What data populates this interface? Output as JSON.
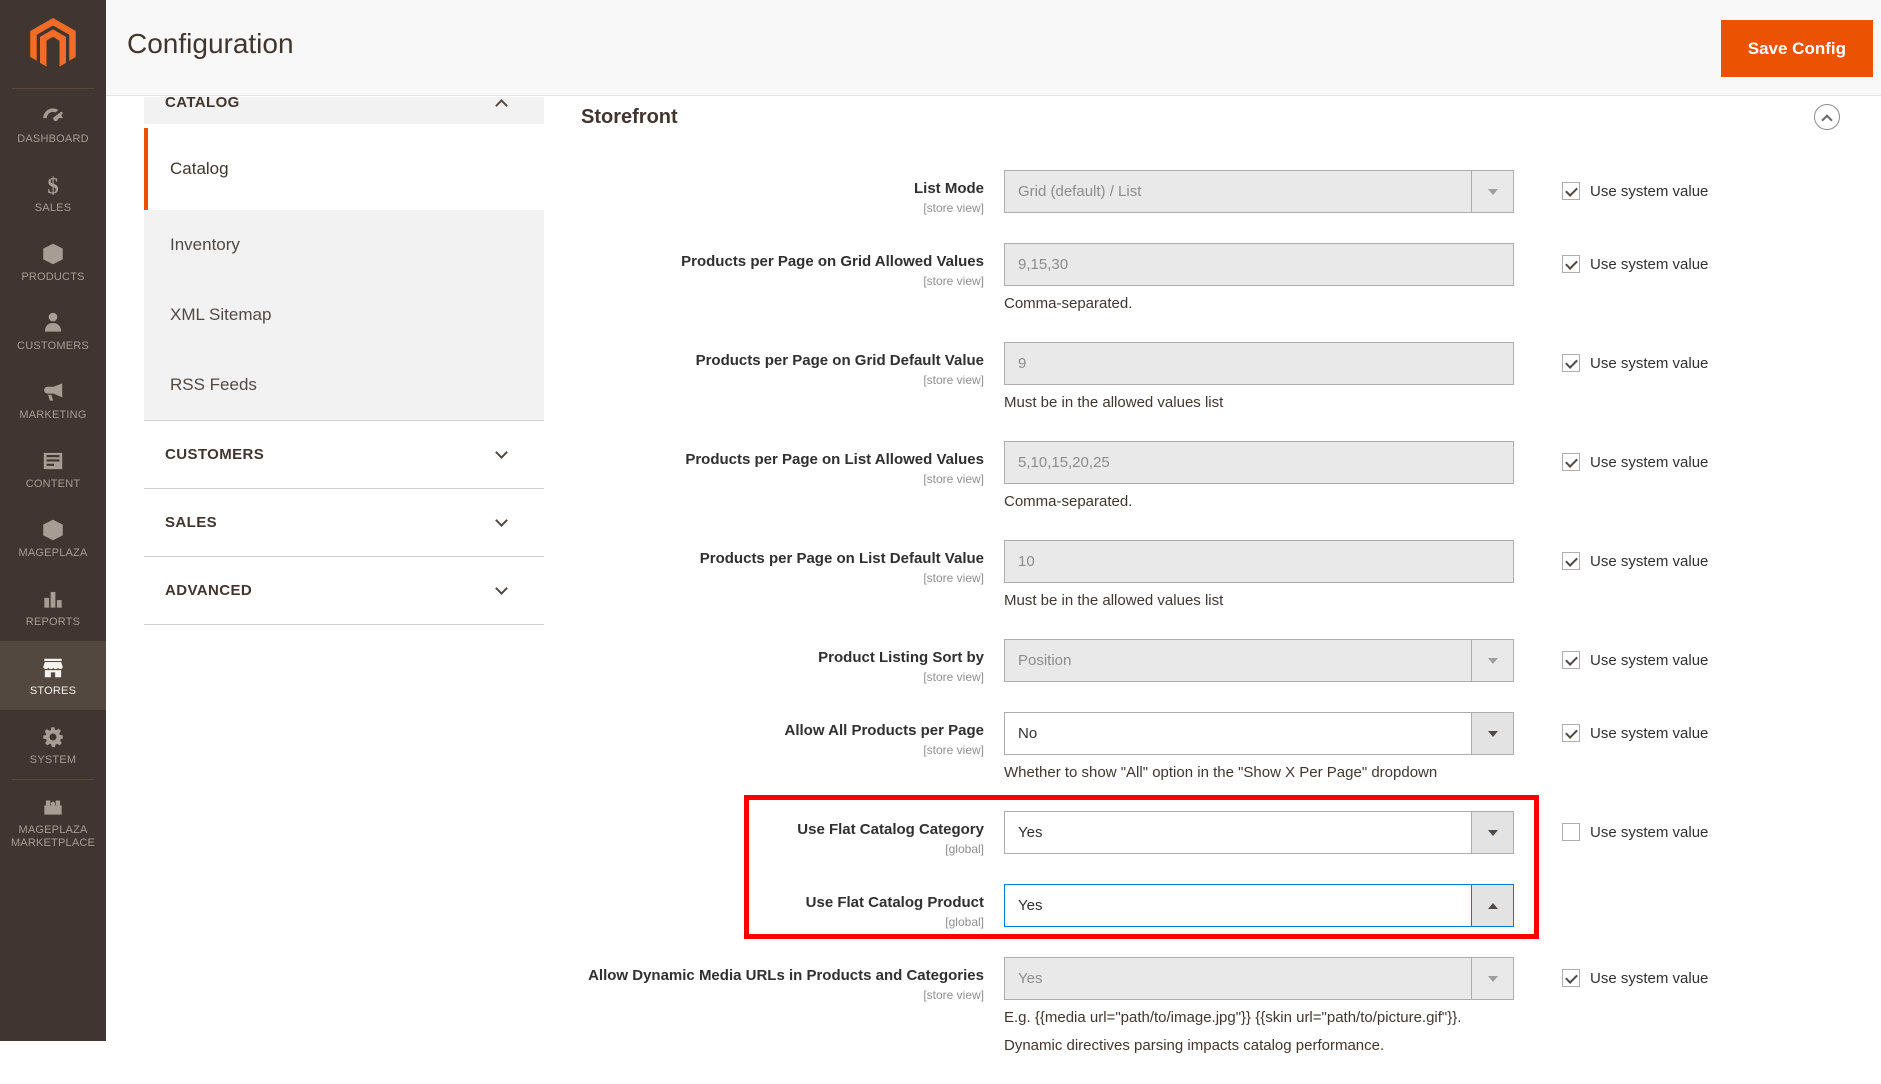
{
  "header": {
    "title": "Configuration",
    "save_button": "Save Config"
  },
  "sidebar": {
    "items": [
      {
        "label": "DASHBOARD",
        "icon": "dashboard-icon",
        "active": false
      },
      {
        "label": "SALES",
        "icon": "sales-icon",
        "active": false
      },
      {
        "label": "PRODUCTS",
        "icon": "products-icon",
        "active": false
      },
      {
        "label": "CUSTOMERS",
        "icon": "customers-icon",
        "active": false
      },
      {
        "label": "MARKETING",
        "icon": "marketing-icon",
        "active": false
      },
      {
        "label": "CONTENT",
        "icon": "content-icon",
        "active": false
      },
      {
        "label": "MAGEPLAZA",
        "icon": "mageplaza-icon",
        "active": false
      },
      {
        "label": "REPORTS",
        "icon": "reports-icon",
        "active": false
      },
      {
        "label": "STORES",
        "icon": "stores-icon",
        "active": true
      },
      {
        "label": "SYSTEM",
        "icon": "system-icon",
        "active": false
      },
      {
        "label": "MAGEPLAZA MARKETPLACE",
        "icon": "marketplace-icon",
        "active": false,
        "separator_before": true
      }
    ]
  },
  "nav": {
    "clipped_group": {
      "label": "CATALOG",
      "chevron": "up"
    },
    "group_items": [
      {
        "label": "Catalog",
        "active": true
      },
      {
        "label": "Inventory",
        "active": false
      },
      {
        "label": "XML Sitemap",
        "active": false
      },
      {
        "label": "RSS Feeds",
        "active": false
      }
    ],
    "sections": [
      {
        "label": "CUSTOMERS",
        "chevron": "down"
      },
      {
        "label": "SALES",
        "chevron": "down"
      },
      {
        "label": "ADVANCED",
        "chevron": "down"
      }
    ]
  },
  "section": {
    "title": "Storefront"
  },
  "form": {
    "use_system_value_label": "Use system value",
    "rows": [
      {
        "label": "List Mode",
        "scope": "[store view]",
        "type": "select",
        "value": "Grid (default) / List",
        "disabled": true,
        "checkbox": "checked"
      },
      {
        "label": "Products per Page on Grid Allowed Values",
        "scope": "[store view]",
        "type": "text",
        "value": "9,15,30",
        "note": "Comma-separated.",
        "disabled": true,
        "checkbox": "checked"
      },
      {
        "label": "Products per Page on Grid Default Value",
        "scope": "[store view]",
        "type": "text",
        "value": "9",
        "note": "Must be in the allowed values list",
        "disabled": true,
        "checkbox": "checked"
      },
      {
        "label": "Products per Page on List Allowed Values",
        "scope": "[store view]",
        "type": "text",
        "value": "5,10,15,20,25",
        "note": "Comma-separated.",
        "disabled": true,
        "checkbox": "checked"
      },
      {
        "label": "Products per Page on List Default Value",
        "scope": "[store view]",
        "type": "text",
        "value": "10",
        "note": "Must be in the allowed values list",
        "disabled": true,
        "checkbox": "checked"
      },
      {
        "label": "Product Listing Sort by",
        "scope": "[store view]",
        "type": "select",
        "value": "Position",
        "disabled": true,
        "checkbox": "checked"
      },
      {
        "label": "Allow All Products per Page",
        "scope": "[store view]",
        "type": "select",
        "value": "No",
        "disabled": false,
        "note": "Whether to show \"All\" option in the \"Show X Per Page\" dropdown",
        "checkbox": "checked"
      },
      {
        "label": "Use Flat Catalog Category",
        "scope": "[global]",
        "type": "select",
        "value": "Yes",
        "disabled": false,
        "checkbox": "unchecked",
        "flagged": true
      },
      {
        "label": "Use Flat Catalog Product",
        "scope": "[global]",
        "type": "select",
        "value": "Yes",
        "disabled": false,
        "focused": true,
        "open": true,
        "checkbox": "none",
        "flagged": true
      },
      {
        "label": "Allow Dynamic Media URLs in Products and Categories",
        "scope": "[store view]",
        "type": "select",
        "value": "Yes",
        "disabled": true,
        "note": "E.g. {{media url=\"path/to/image.jpg\"}} {{skin url=\"path/to/picture.gif\"}}.",
        "note2": "Dynamic directives parsing impacts catalog performance.",
        "checkbox": "checked"
      }
    ]
  },
  "annotation": {
    "color": "#fb0102"
  },
  "colors": {
    "accent": "#eb5202",
    "focus": "#007bdb",
    "sidebar_bg": "#41362f"
  }
}
